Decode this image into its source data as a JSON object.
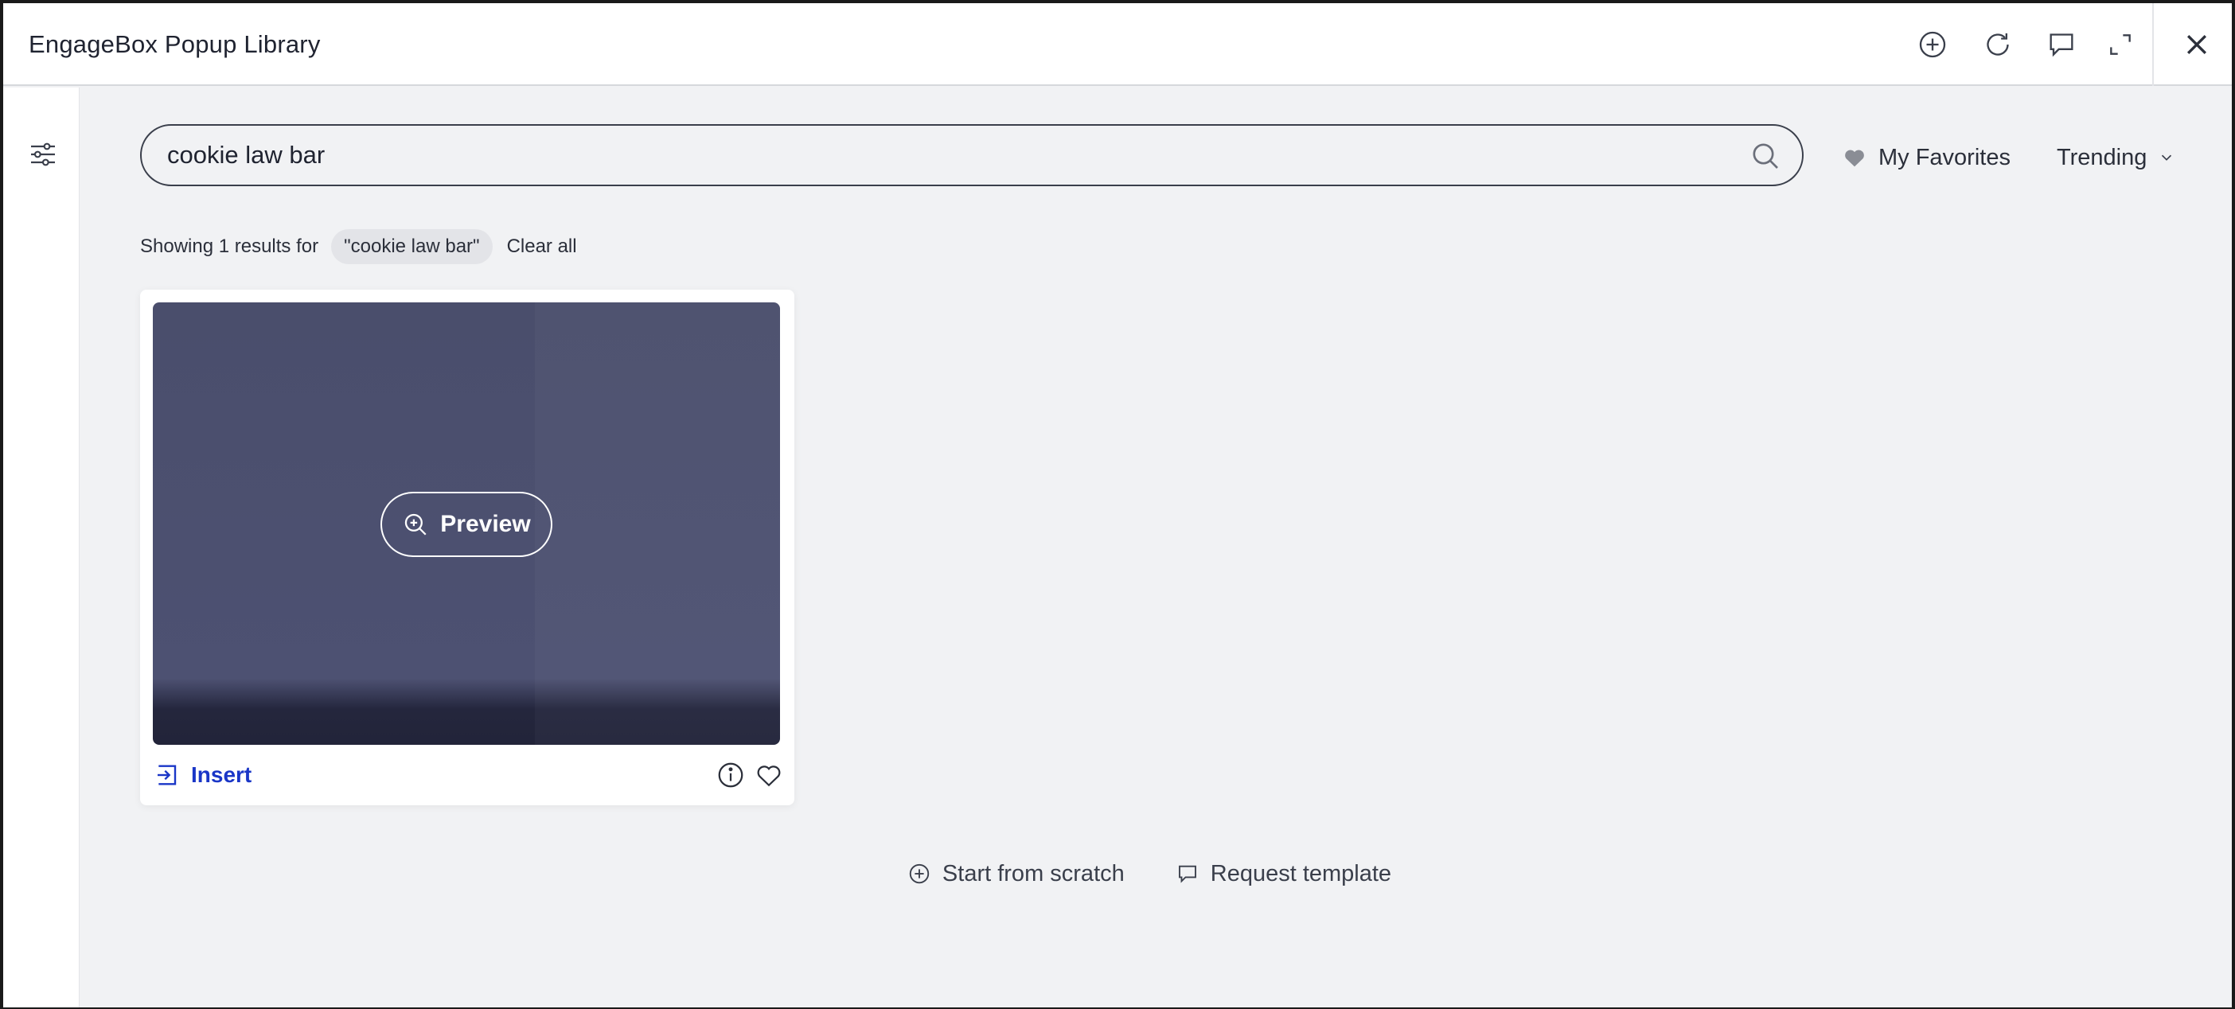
{
  "window": {
    "title": "EngageBox Popup Library"
  },
  "titlebar_icons": [
    "plus-circle-icon",
    "refresh-icon",
    "comment-icon",
    "expand-icon",
    "close-icon"
  ],
  "search": {
    "value": "cookie law bar",
    "placeholder": ""
  },
  "toolbar": {
    "favorites_label": "My Favorites",
    "sort_label": "Trending"
  },
  "results": {
    "prefix": "Showing 1 results for",
    "query_chip": "\"cookie law bar\"",
    "clear_label": "Clear all"
  },
  "templates": [
    {
      "preview_label": "Preview",
      "insert_label": "Insert"
    }
  ],
  "footer": {
    "scratch_label": "Start from scratch",
    "request_label": "Request template"
  },
  "colors": {
    "accent": "#1a36c7",
    "thumbnail": "#4a4e6c",
    "background": "#f1f2f4"
  }
}
